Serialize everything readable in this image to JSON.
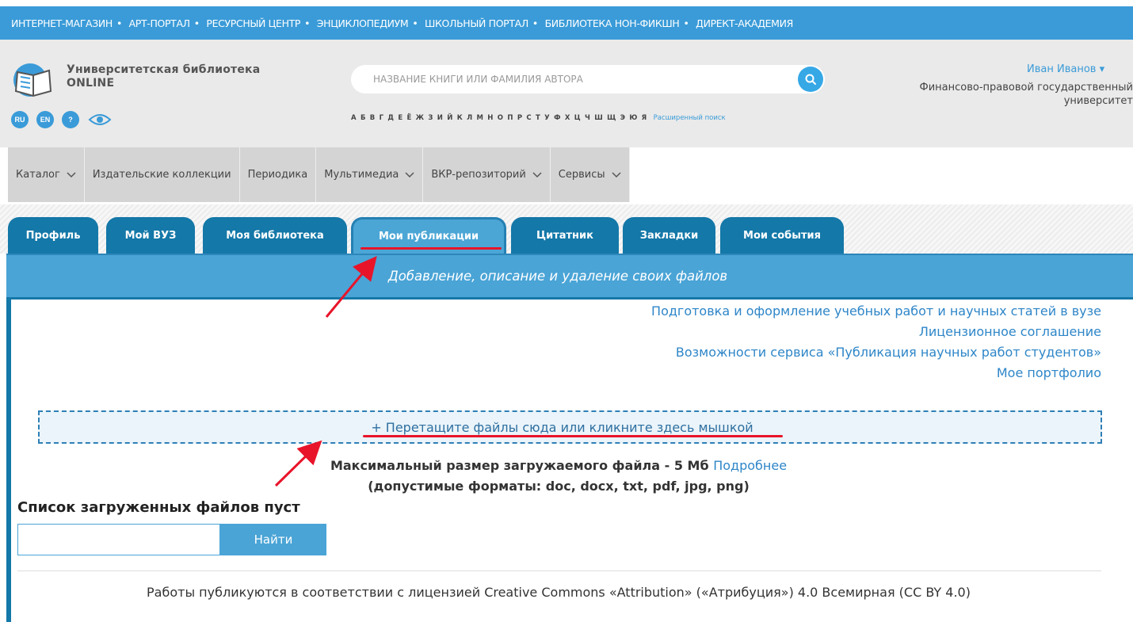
{
  "portal_links": [
    "ИНТЕРНЕТ-МАГАЗИН",
    "АРТ-ПОРТАЛ",
    "РЕСУРСНЫЙ ЦЕНТР",
    "ЭНЦИКЛОПЕДИУМ",
    "ШКОЛЬНЫЙ ПОРТАЛ",
    "БИБЛИОТЕКА НОН-ФИКШН",
    "ДИРЕКТ-АКАДЕМИЯ"
  ],
  "logo": {
    "line1": "Университетская библиотека",
    "line2": "ONLINE"
  },
  "lang": {
    "ru": "RU",
    "en": "EN",
    "help": "?"
  },
  "search": {
    "placeholder": "НАЗВАНИЕ КНИГИ ИЛИ ФАМИЛИЯ АВТОРА"
  },
  "alphabet": {
    "letters": "А Б В Г Д Е Ё Ж З И Й К Л М Н О П Р С Т У Ф Х Ц Ч Ш Щ Э Ю Я",
    "advanced": "Расширенный поиск"
  },
  "user": {
    "name": "Иван Иванов ▾",
    "university": "Финансово-правовой государственный университет"
  },
  "nav": [
    {
      "label": "Каталог",
      "dropdown": true
    },
    {
      "label": "Издательские коллекции",
      "dropdown": false
    },
    {
      "label": "Периодика",
      "dropdown": false
    },
    {
      "label": "Мультимедиа",
      "dropdown": true
    },
    {
      "label": "ВКР-репозиторий",
      "dropdown": true
    },
    {
      "label": "Сервисы",
      "dropdown": true
    }
  ],
  "tabs": [
    {
      "label": "Профиль"
    },
    {
      "label": "Мой ВУЗ"
    },
    {
      "label": "Моя библиотека"
    },
    {
      "label": "Мои публикации"
    },
    {
      "label": "Цитатник"
    },
    {
      "label": "Закладки"
    },
    {
      "label": "Мои события"
    }
  ],
  "active_tab": "Мои публикации",
  "band": {
    "text": "Добавление, описание и удаление своих файлов"
  },
  "links": [
    "Подготовка и оформление учебных работ и научных статей в вузе",
    "Лицензионное соглашение",
    "Возможности сервиса «Публикация научных работ студентов»",
    "Мое портфолио"
  ],
  "dropzone": {
    "text": "+ Перетащите файлы сюда или кликните здесь мышкой"
  },
  "upload": {
    "max_size": "Максимальный размер загружаемого файла - 5 Мб",
    "more": "Подробнее",
    "formats": "(допустимые форматы: doc, docx, txt, pdf, jpg, png)"
  },
  "files": {
    "empty_title": "Список загруженных файлов пуст",
    "find_button": "Найти"
  },
  "license": "Работы публикуются в соответствии с лицензией Creative Commons «Attribution» («Атрибуция») 4.0 Всемирная (CC BY 4.0)",
  "colors": {
    "primary": "#1478a8",
    "accent": "#4aa4d6",
    "link": "#2e86c8",
    "annotation": "#e8142a"
  }
}
